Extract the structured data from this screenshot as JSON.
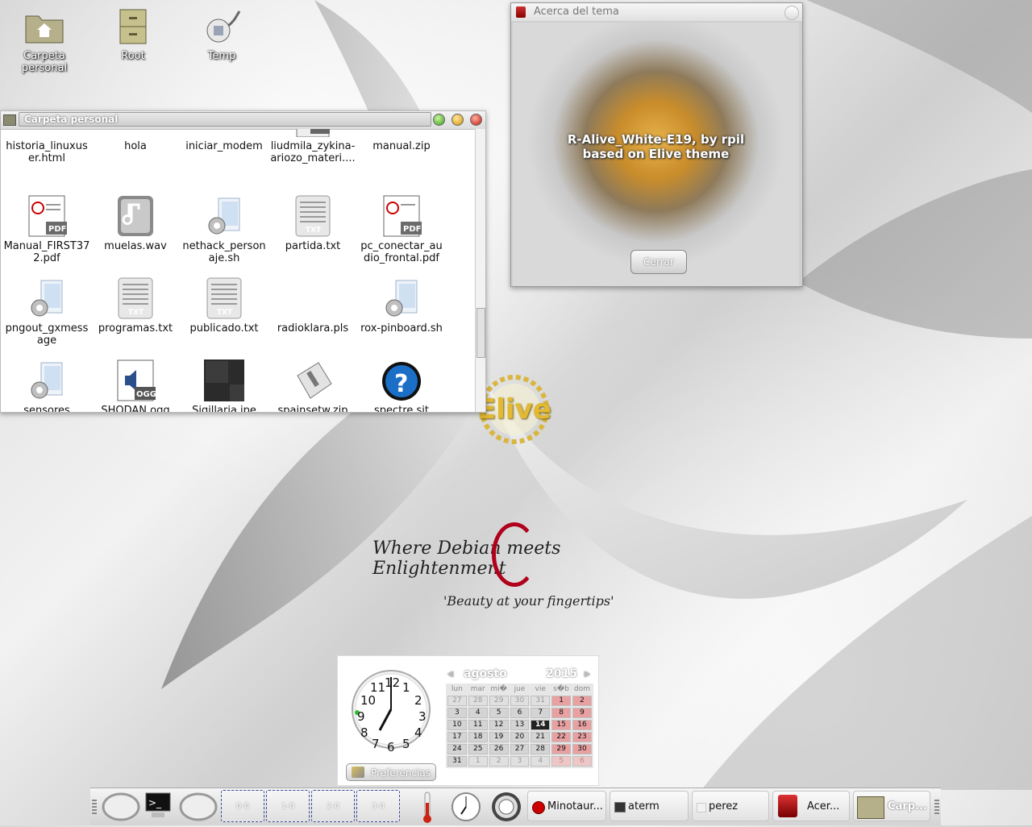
{
  "desktop": {
    "icons": [
      {
        "label": "Carpeta personal",
        "icon": "folder-home-icon"
      },
      {
        "label": "Root",
        "icon": "cabinet-icon"
      },
      {
        "label": "Temp",
        "icon": "plug-icon"
      }
    ],
    "wallpaper": {
      "logo_text": "Elive",
      "tagline": "Where Debian meets Enlightenment",
      "subtagline": "'Beauty at your fingertips'"
    }
  },
  "file_manager": {
    "title": "Carpeta personal",
    "items": [
      {
        "name": "historia_linuxuser.html",
        "display": "historia_linuxus\ner.html",
        "icon": "html-icon"
      },
      {
        "name": "hola",
        "display": "hola",
        "icon": "script-icon"
      },
      {
        "name": "iniciar_modem",
        "display": "iniciar_modem",
        "icon": "script-icon"
      },
      {
        "name": "liudmila_zykina-ariozo_materi....",
        "display": "liudmila_zykina-\nariozo_materi....",
        "icon": "pdf-icon"
      },
      {
        "name": "manual.zip",
        "display": "manual.zip",
        "icon": "zip-icon"
      },
      {
        "name": "Manual_FIRST372.pdf",
        "display": "Manual_FIRST37\n2.pdf",
        "icon": "pdf-icon"
      },
      {
        "name": "muelas.wav",
        "display": "muelas.wav",
        "icon": "audio-wav-icon"
      },
      {
        "name": "nethack_personaje.sh",
        "display": "nethack_person\naje.sh",
        "icon": "script-icon"
      },
      {
        "name": "partida.txt",
        "display": "partida.txt",
        "icon": "text-file-icon"
      },
      {
        "name": "pc_conectar_audio_frontal.pdf",
        "display": "pc_conectar_au\ndio_frontal.pdf",
        "icon": "pdf-icon"
      },
      {
        "name": "pngout_gxmessage",
        "display": "pngout_gxmess\nage",
        "icon": "script-icon"
      },
      {
        "name": "programas.txt",
        "display": "programas.txt",
        "icon": "text-file-icon"
      },
      {
        "name": "publicado.txt",
        "display": "publicado.txt",
        "icon": "text-file-icon"
      },
      {
        "name": "radioklara.pls",
        "display": "radioklara.pls",
        "icon": "blank-file-icon"
      },
      {
        "name": "rox-pinboard.sh",
        "display": "rox-pinboard.sh",
        "icon": "script-icon"
      },
      {
        "name": "sensores",
        "display": "sensores",
        "icon": "script-icon"
      },
      {
        "name": "SHODAN.ogg",
        "display": "SHODAN.ogg",
        "icon": "audio-ogg-icon"
      },
      {
        "name": "Sigillaria.jpe",
        "display": "Sigillaria.jpe",
        "icon": "image-thumbnail-icon"
      },
      {
        "name": "spainsetw.zip",
        "display": "spainsetw.zip",
        "icon": "zip-icon"
      },
      {
        "name": "spectre.sit",
        "display": "spectre.sit",
        "icon": "question-icon"
      }
    ]
  },
  "about_dialog": {
    "title": "Acerca del tema",
    "message_line1": "R-Alive_White-E19, by rpil",
    "message_line2": "based on Elive theme",
    "close_label": "Cerrar"
  },
  "clock": {
    "time": "7:00",
    "numbers": [
      "12",
      "1",
      "2",
      "3",
      "4",
      "5",
      "6",
      "7",
      "8",
      "9",
      "10",
      "11"
    ]
  },
  "calendar": {
    "month": "agosto",
    "year": "2015",
    "weekdays": [
      "lun",
      "mar",
      "mi�",
      "jue",
      "vie",
      "s�b",
      "dom"
    ],
    "weeks": [
      [
        "27",
        "28",
        "29",
        "30",
        "31",
        "1",
        "2"
      ],
      [
        "3",
        "4",
        "5",
        "6",
        "7",
        "8",
        "9"
      ],
      [
        "10",
        "11",
        "12",
        "13",
        "14",
        "15",
        "16"
      ],
      [
        "17",
        "18",
        "19",
        "20",
        "21",
        "22",
        "23"
      ],
      [
        "24",
        "25",
        "26",
        "27",
        "28",
        "29",
        "30"
      ],
      [
        "31",
        "1",
        "2",
        "3",
        "4",
        "5",
        "6"
      ]
    ],
    "today": "14",
    "preferences_label": "Preferencias"
  },
  "taskbar": {
    "pager": [
      "0-0",
      "1-0",
      "2-0",
      "3-0"
    ],
    "tasks": [
      {
        "label": "Minotaur...",
        "icon": "stop-icon"
      },
      {
        "label": "aterm",
        "icon": "terminal-icon"
      },
      {
        "label": "perez",
        "icon": "window-icon"
      },
      {
        "label": "Acer...",
        "icon": "paint-bucket-icon"
      },
      {
        "label": "Carp...",
        "icon": "folder-home-icon"
      }
    ]
  }
}
